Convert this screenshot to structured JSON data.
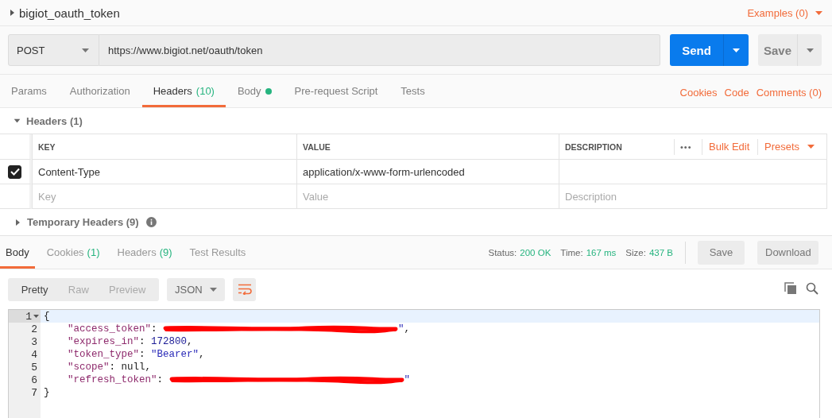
{
  "request": {
    "name": "bigiot_oauth_token",
    "examples": "Examples (0)",
    "method": "POST",
    "url": "https://www.bigiot.net/oauth/token",
    "send": "Send",
    "save": "Save"
  },
  "request_tabs": [
    {
      "label": "Params",
      "selected": false
    },
    {
      "label": "Authorization",
      "selected": false
    },
    {
      "label": "Headers",
      "count": "(10)",
      "selected": true
    },
    {
      "label": "Body",
      "dot": true,
      "selected": false
    },
    {
      "label": "Pre-request Script",
      "selected": false
    },
    {
      "label": "Tests",
      "selected": false
    }
  ],
  "request_links": [
    "Cookies",
    "Code",
    "Comments (0)"
  ],
  "headers": {
    "title": "Headers (1)",
    "expanded": true,
    "columns": [
      "KEY",
      "VALUE",
      "DESCRIPTION"
    ],
    "more": "•••",
    "bulk_edit": "Bulk Edit",
    "presets": "Presets",
    "rows": [
      {
        "checked": true,
        "key": "Content-Type",
        "value": "application/x-www-form-urlencoded"
      }
    ],
    "new_row": [
      {
        "placeholder": "Key"
      },
      {
        "placeholder": "Value"
      },
      {
        "placeholder": "Description"
      }
    ]
  },
  "temporary_headers": {
    "title": "Temporary Headers (9)",
    "expanded": false
  },
  "response_tabs": [
    {
      "label": "Body",
      "selected": true
    },
    {
      "label": "Cookies",
      "count": "(1)",
      "selected": false
    },
    {
      "label": "Headers",
      "count": "(9)",
      "selected": false
    },
    {
      "label": "Test Results",
      "selected": false
    }
  ],
  "status": [
    {
      "label": "Status:",
      "value": "200 OK"
    },
    {
      "label": "Time:",
      "value": "167 ms"
    },
    {
      "label": "Size:",
      "value": "437 B"
    }
  ],
  "response_buttons": [
    "Save",
    "Download"
  ],
  "view_modes": [
    {
      "label": "Pretty",
      "selected": true
    },
    {
      "label": "Raw",
      "selected": false
    },
    {
      "label": "Preview",
      "selected": false
    }
  ],
  "format": "JSON",
  "code": {
    "line_numbers": [
      {
        "number": "1",
        "active": true
      },
      {
        "number": "2",
        "active": false
      },
      {
        "number": "3",
        "active": false
      },
      {
        "number": "4",
        "active": false
      },
      {
        "number": "5",
        "active": false
      },
      {
        "number": "6",
        "active": false
      },
      {
        "number": "7",
        "active": false
      }
    ],
    "open": "{",
    "close": "}",
    "entries": [
      {
        "key": "\"access_token\"",
        "colon": ":",
        "kind": "redacted",
        "value_end": "\"",
        "tail": ","
      },
      {
        "key": "\"expires_in\"",
        "colon": ":",
        "kind": "number",
        "value": "172800",
        "tail": ","
      },
      {
        "key": "\"token_type\"",
        "colon": ":",
        "kind": "string",
        "value": "\"Bearer\"",
        "tail": ","
      },
      {
        "key": "\"scope\"",
        "colon": ":",
        "kind": "null",
        "value": "null",
        "tail": ","
      },
      {
        "key": "\"refresh_token\"",
        "colon": ":",
        "kind": "redacted",
        "value_end": "\""
      }
    ]
  }
}
